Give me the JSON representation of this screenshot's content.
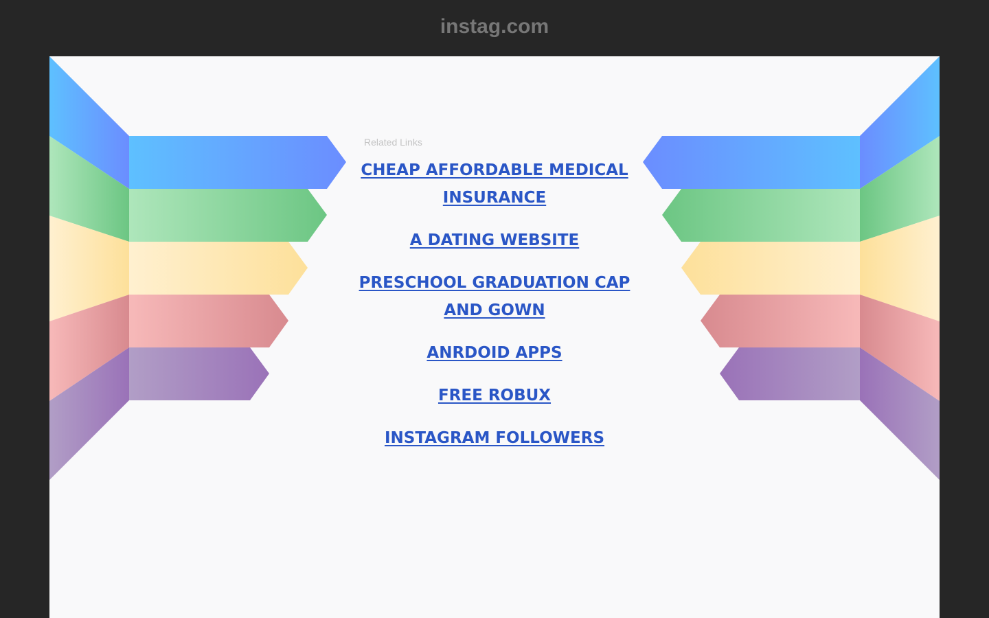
{
  "header": {
    "site_name": "instag.com"
  },
  "main": {
    "related_label": "Related Links",
    "links": [
      {
        "label": "CHEAP AFFORDABLE MEDICAL INSURANCE"
      },
      {
        "label": "A DATING WEBSITE"
      },
      {
        "label": "PRESCHOOL GRADUATION CAP AND GOWN"
      },
      {
        "label": "ANRDOID APPS"
      },
      {
        "label": "FREE ROBUX"
      },
      {
        "label": "INSTAGRAM FOLLOWERS"
      }
    ]
  },
  "colors": {
    "page_background": "#262626",
    "panel_background": "#f9f9fa",
    "title_color": "#777777",
    "link_color": "#2a56c6",
    "ribbon_blue": "#5ec0ff",
    "ribbon_blue_dark": "#6b8dff",
    "ribbon_green": "#aee6bb",
    "ribbon_green_dark": "#6cc683",
    "ribbon_yellow": "#fff0d0",
    "ribbon_yellow_dark": "#fde09a",
    "ribbon_red": "#f7b9b9",
    "ribbon_red_dark": "#d88a8f",
    "ribbon_purple": "#b19ec6",
    "ribbon_purple_dark": "#9a72b8"
  }
}
